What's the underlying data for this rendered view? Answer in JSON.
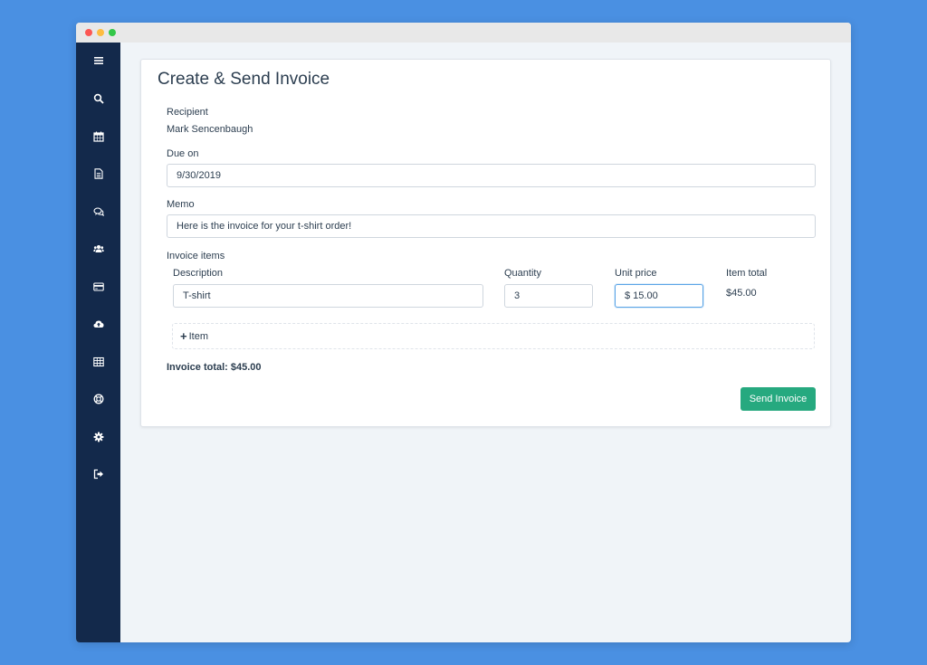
{
  "window": {
    "traffic_lights": [
      "close",
      "minimize",
      "zoom"
    ]
  },
  "sidebar": {
    "items": [
      {
        "icon": "menu-icon"
      },
      {
        "icon": "search-icon"
      },
      {
        "icon": "calendar-icon"
      },
      {
        "icon": "document-icon"
      },
      {
        "icon": "chat-icon"
      },
      {
        "icon": "users-icon"
      },
      {
        "icon": "credit-card-icon"
      },
      {
        "icon": "cloud-upload-icon"
      },
      {
        "icon": "table-icon"
      },
      {
        "icon": "help-icon"
      },
      {
        "icon": "gear-icon"
      },
      {
        "icon": "sign-out-icon"
      }
    ]
  },
  "form": {
    "title": "Create & Send Invoice",
    "recipient_label": "Recipient",
    "recipient_value": "Mark Sencenbaugh",
    "due_label": "Due on",
    "due_value": "9/30/2019",
    "memo_label": "Memo",
    "memo_value": "Here is the invoice for your t-shirt order!",
    "items_label": "Invoice items",
    "columns": {
      "description": "Description",
      "quantity": "Quantity",
      "unit_price": "Unit price",
      "item_total": "Item total"
    },
    "item": {
      "description": "T-shirt",
      "quantity": "3",
      "unit_price": "$ 15.00",
      "item_total": "$45.00"
    },
    "add_item_label": "Item",
    "invoice_total": "Invoice total: $45.00",
    "send_button": "Send Invoice"
  },
  "colors": {
    "background": "#4a90e2",
    "sidebar": "#13294b",
    "primary_button": "#26a97f",
    "text": "#2c3e50"
  }
}
